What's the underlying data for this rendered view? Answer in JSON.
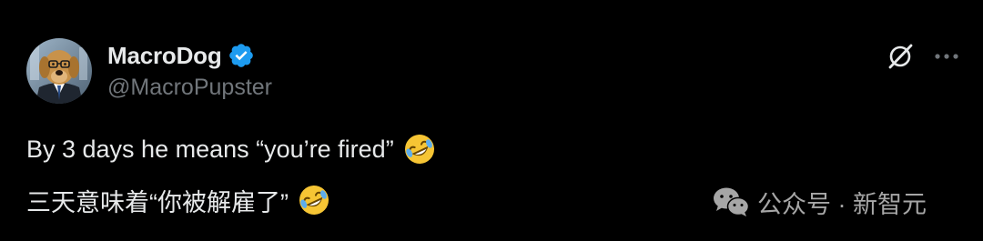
{
  "author": {
    "display_name": "MacroDog",
    "handle": "@MacroPupster",
    "avatar_icon": "golden-retriever-in-suit-avatar",
    "verified_icon": "verified-badge-icon",
    "verified_color": "#1d9bf0"
  },
  "header_actions": {
    "grok_icon": "grok-icon",
    "more_icon": "more-options-icon"
  },
  "tweet": {
    "line_1": "By 3 days he means “you’re fired”",
    "line_2": "三天意味着“你被解雇了”",
    "emoji": "rolling-on-floor-laughing-emoji"
  },
  "watermark": {
    "icon": "wechat-icon",
    "text": "公众号 · 新智元"
  },
  "colors": {
    "background": "#000000",
    "primary_text": "#e7e9ea",
    "secondary_text": "#71767b"
  }
}
